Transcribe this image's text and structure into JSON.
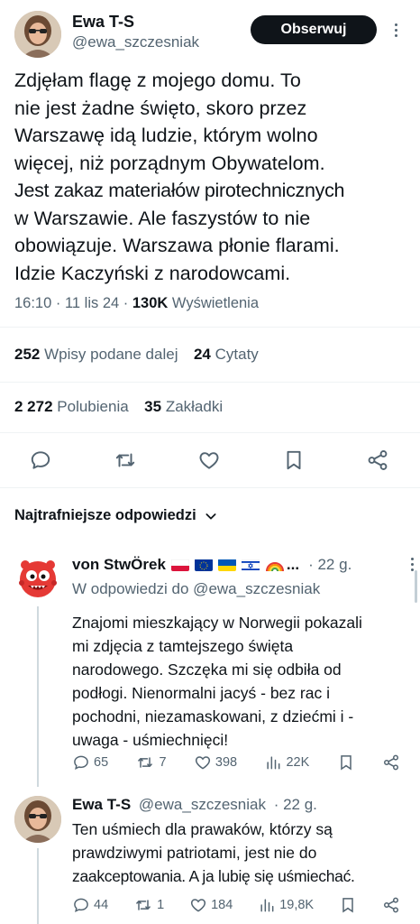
{
  "author": {
    "name": "Ewa T-S",
    "handle": "@ewa_szczesniak",
    "follow_label": "Obserwuj"
  },
  "tweet": {
    "lines": [
      "Zdjęłam flagę z mojego domu. To",
      "nie jest żadne święto, skoro przez",
      "Warszawę idą ludzie, którym wolno",
      "więcej, niż porządnym Obywatelom.",
      "Jest zakaz materiałów pirotechnicznych",
      "w Warszawie. Ale faszystów to nie",
      "obowiązuje. Warszawa płonie flarami.",
      "Idzie Kaczyński z narodowcami."
    ],
    "time": "16:10 · 11 lis 24 · ",
    "views_count": "130K",
    "views_label": " Wyświetlenia"
  },
  "stats": {
    "reposts_count": "252",
    "reposts_label": "Wpisy podane dalej",
    "quotes_count": "24",
    "quotes_label": "Cytaty",
    "likes_count": "2 272",
    "likes_label": "Polubienia",
    "bookmarks_count": "35",
    "bookmarks_label": "Zakładki"
  },
  "replies_header": "Najtrafniejsze odpowiedzi",
  "replies": [
    {
      "name": "von StwÖrek",
      "ellipsis": "...",
      "time": "· 22 g.",
      "reply_to": "W odpowiedzi do @ewa_szczesniak",
      "lines": [
        "Znajomi mieszkający w Norwegii pokazali",
        "mi zdjęcia z tamtejszego święta",
        "narodowego. Szczęka mi się odbiła od",
        "podłogi. Nienormalni jacyś - bez rac i",
        "pochodni, niezamaskowani, z dziećmi i -",
        "uwaga - uśmiechnięci!"
      ],
      "comments": "65",
      "reposts": "7",
      "likes": "398",
      "views": "22K"
    },
    {
      "name": "Ewa T-S",
      "handle": "@ewa_szczesniak",
      "time": "· 22 g.",
      "lines": [
        "Ten uśmiech dla prawaków, którzy są",
        "prawdziwymi patriotami, jest nie do",
        "zaakceptowania. A ja lubię się uśmiechać."
      ],
      "comments": "44",
      "reposts": "1",
      "likes": "184",
      "views": "19,8K"
    }
  ]
}
